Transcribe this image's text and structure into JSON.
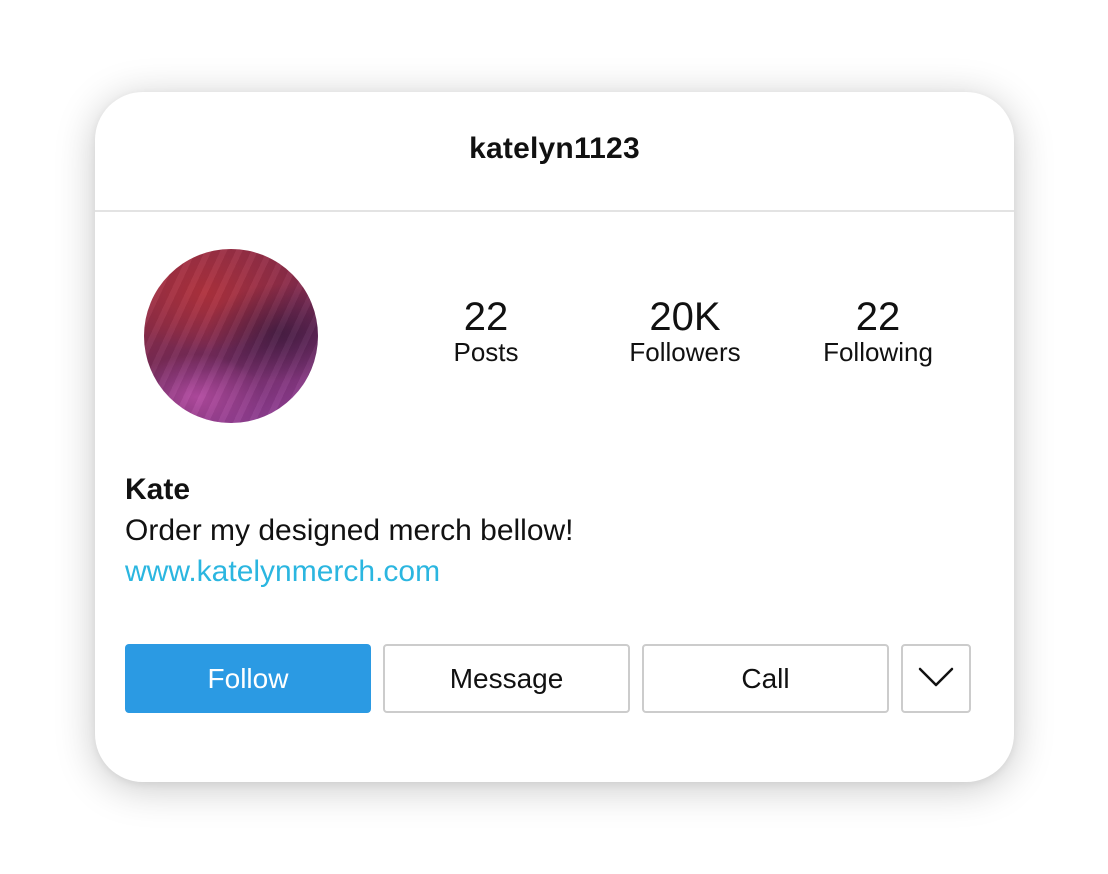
{
  "header": {
    "username": "katelyn1123"
  },
  "stats": {
    "posts": {
      "value": "22",
      "label": "Posts"
    },
    "followers": {
      "value": "20K",
      "label": "Followers"
    },
    "following": {
      "value": "22",
      "label": "Following"
    }
  },
  "bio": {
    "name": "Kate",
    "description": "Order my designed merch bellow!",
    "link": "www.katelynmerch.com"
  },
  "actions": {
    "follow_label": "Follow",
    "message_label": "Message",
    "call_label": "Call",
    "more_icon": "chevron-down-icon"
  },
  "colors": {
    "follow_button": "#2b9ae3",
    "link": "#2bb6e0"
  }
}
